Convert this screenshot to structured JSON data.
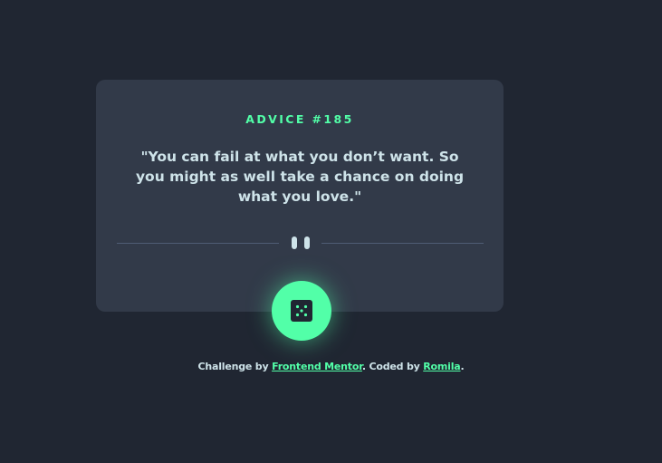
{
  "advice": {
    "title": "ADVICE #185",
    "quote": "\"You can fail at what you don’t want. So you might as well take a chance on doing what you love.\""
  },
  "divider": {
    "icon": "pause-icon"
  },
  "button": {
    "icon": "dice-icon"
  },
  "footer": {
    "prefix": "Challenge by ",
    "challenge_link": "Frontend Mentor",
    "middle": ". Coded by ",
    "author_link": "Romila",
    "suffix": "."
  },
  "colors": {
    "background": "#202632",
    "card": "#323a49",
    "accent": "#52ffa8",
    "text": "#cee3e9",
    "divider": "#4f5d74"
  }
}
